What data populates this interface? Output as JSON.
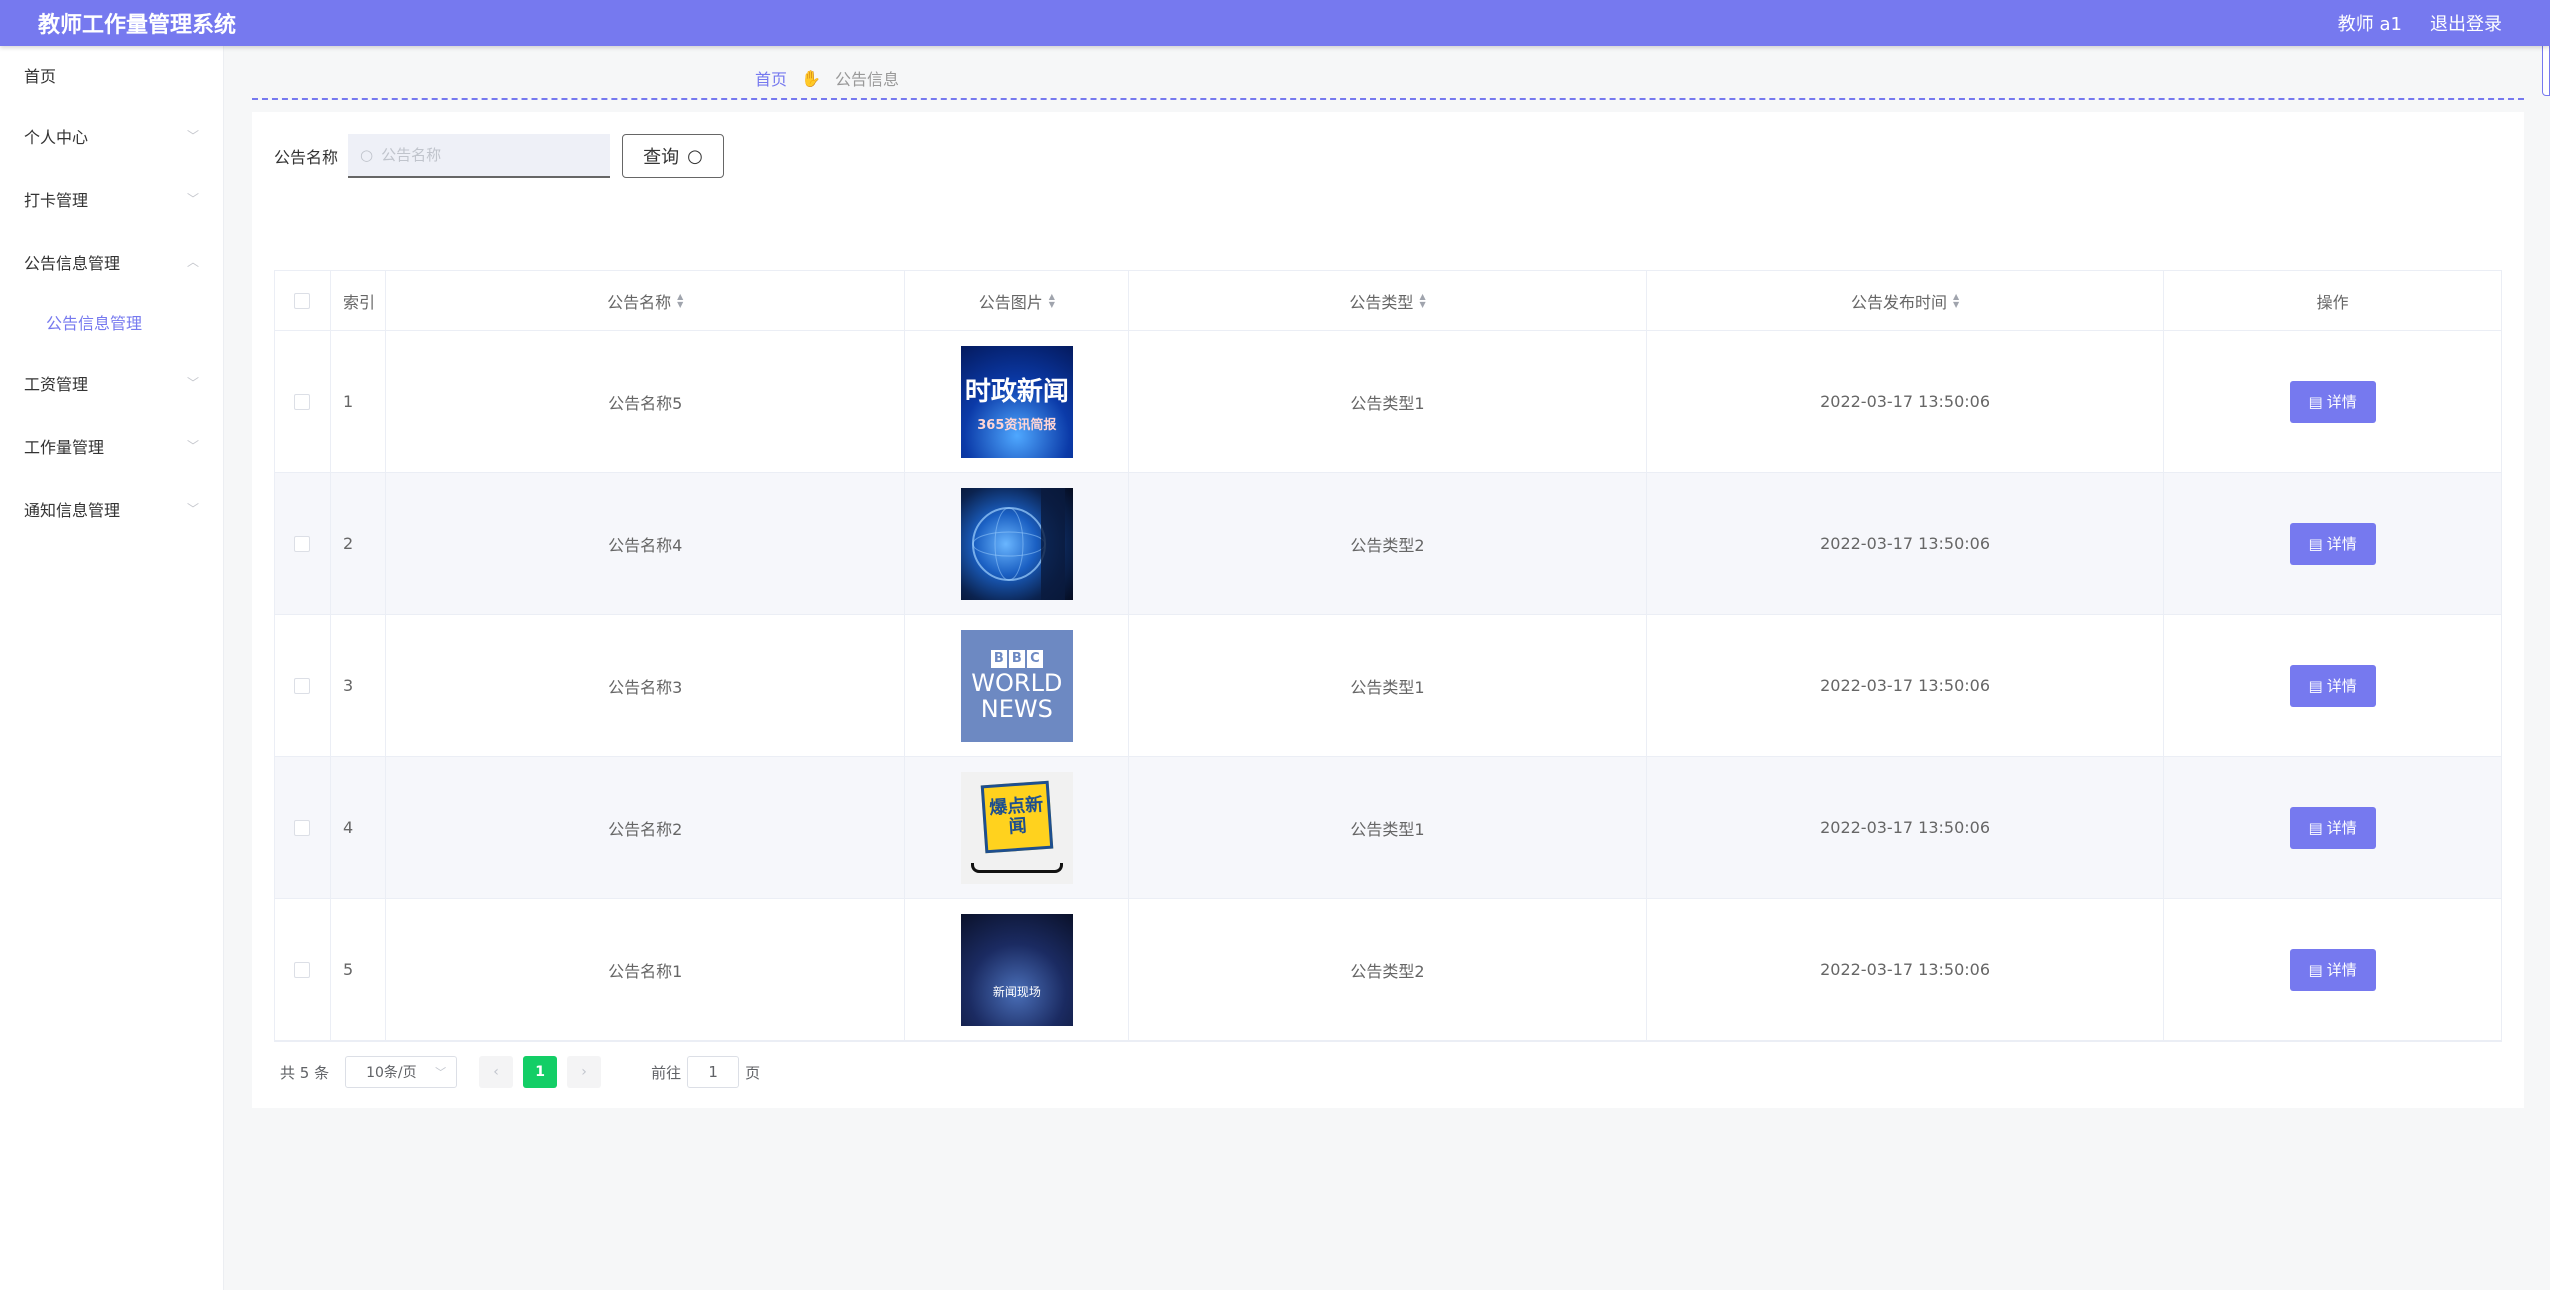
{
  "header": {
    "app_title": "教师工作量管理系统",
    "user_label": "教师 a1",
    "logout_label": "退出登录",
    "accent_color": "#7679ef"
  },
  "sidebar": {
    "items": [
      {
        "label": "首页"
      },
      {
        "label": "个人中心"
      },
      {
        "label": "打卡管理"
      },
      {
        "label": "公告信息管理"
      },
      {
        "label": "公告信息管理",
        "sub": true,
        "active": true
      },
      {
        "label": "工资管理"
      },
      {
        "label": "工作量管理"
      },
      {
        "label": "通知信息管理"
      }
    ]
  },
  "breadcrumb": {
    "home": "首页",
    "current": "公告信息"
  },
  "search": {
    "label": "公告名称",
    "placeholder": "公告名称",
    "button_label": "查询"
  },
  "table": {
    "headers": {
      "index": "索引",
      "name": "公告名称",
      "image": "公告图片",
      "type": "公告类型",
      "time": "公告发布时间",
      "operation": "操作"
    },
    "rows": [
      {
        "index": "1",
        "name": "公告名称5",
        "type": "公告类型1",
        "time": "2022-03-17 13:50:06",
        "image_text": "时政新闻",
        "image_subtext": "365资讯简报"
      },
      {
        "index": "2",
        "name": "公告名称4",
        "type": "公告类型2",
        "time": "2022-03-17 13:50:06"
      },
      {
        "index": "3",
        "name": "公告名称3",
        "type": "公告类型1",
        "time": "2022-03-17 13:50:06",
        "image_line1": "WORLD",
        "image_line2": "NEWS"
      },
      {
        "index": "4",
        "name": "公告名称2",
        "type": "公告类型1",
        "time": "2022-03-17 13:50:06",
        "image_text": "爆点新闻"
      },
      {
        "index": "5",
        "name": "公告名称1",
        "type": "公告类型2",
        "time": "2022-03-17 13:50:06",
        "image_text": "新闻现场"
      }
    ],
    "detail_label": "详情"
  },
  "pagination": {
    "total": "共 5 条",
    "page_size": "10条/页",
    "current_page": "1",
    "goto_prefix": "前往",
    "goto_value": "1",
    "goto_suffix": "页"
  }
}
